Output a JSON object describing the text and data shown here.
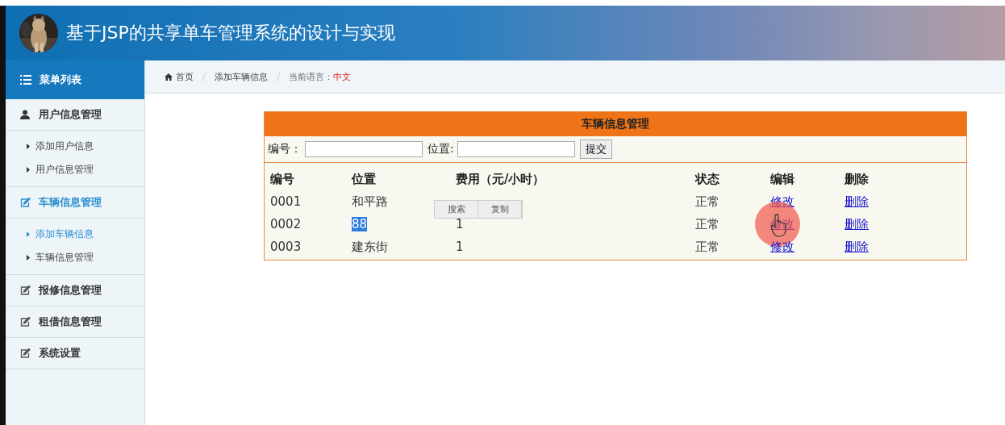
{
  "header": {
    "title": "基于JSP的共享单车管理系统的设计与实现"
  },
  "sidebar": {
    "title": "菜单列表",
    "groups": [
      {
        "label": "用户信息管理",
        "kind": "user",
        "selected": false,
        "children": [
          {
            "label": "添加用户信息",
            "selected": false
          },
          {
            "label": "用户信息管理",
            "selected": false
          }
        ]
      },
      {
        "label": "车辆信息管理",
        "kind": "edit",
        "selected": true,
        "children": [
          {
            "label": "添加车辆信息",
            "selected": true
          },
          {
            "label": "车辆信息管理",
            "selected": false
          }
        ]
      },
      {
        "label": "报修信息管理",
        "kind": "edit",
        "selected": false
      },
      {
        "label": "租借信息管理",
        "kind": "edit",
        "selected": false
      },
      {
        "label": "系统设置",
        "kind": "edit",
        "selected": false
      }
    ]
  },
  "breadcrumb": {
    "items": [
      "首页",
      "添加车辆信息"
    ],
    "language_label": "当前语言：",
    "language": "中文"
  },
  "panel": {
    "title": "车辆信息管理",
    "search": {
      "fields": [
        {
          "label": "编号："
        },
        {
          "label": "位置:"
        }
      ],
      "button": "提交"
    },
    "columns": [
      "编号",
      "位置",
      "费用（元/小时）",
      "状态",
      "编辑",
      "删除"
    ],
    "rows": [
      {
        "id": "0001",
        "location": "和平路",
        "status": "正常",
        "edit": "修改",
        "delete": "删除",
        "location_selected": false,
        "pointer": false
      },
      {
        "id": "0002",
        "location": "88",
        "fee": "1",
        "status": "正常",
        "edit": "修改",
        "delete": "删除",
        "location_selected": true,
        "pointer": true
      },
      {
        "id": "0003",
        "location": "建东街",
        "fee": "1",
        "status": "正常",
        "edit": "修改",
        "delete": "删除",
        "location_selected": false,
        "pointer": false
      }
    ]
  },
  "context_menu": {
    "items": [
      "搜索",
      "复制"
    ]
  }
}
